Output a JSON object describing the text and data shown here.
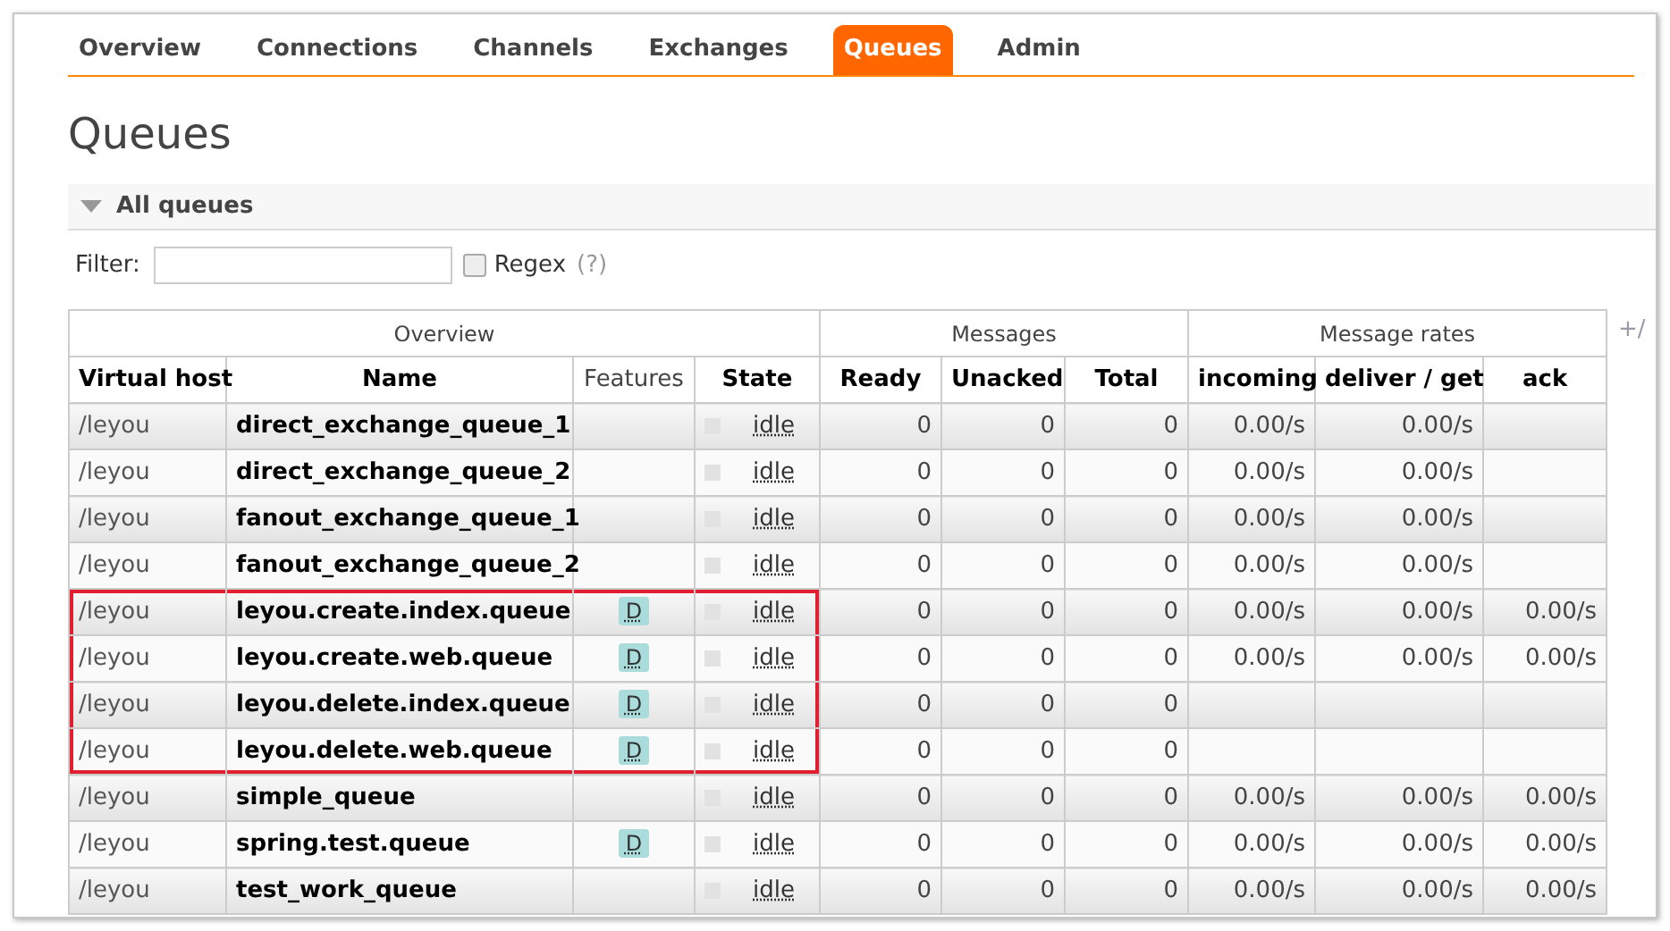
{
  "tabs": [
    {
      "label": "Overview",
      "selected": false
    },
    {
      "label": "Connections",
      "selected": false
    },
    {
      "label": "Channels",
      "selected": false
    },
    {
      "label": "Exchanges",
      "selected": false
    },
    {
      "label": "Queues",
      "selected": true
    },
    {
      "label": "Admin",
      "selected": false
    }
  ],
  "title": "Queues",
  "section": {
    "label": "All queues",
    "expanded": true
  },
  "filter": {
    "label": "Filter:",
    "regex_label": "Regex",
    "regex_checked": false,
    "help": "(?)"
  },
  "table": {
    "groups": [
      "Overview",
      "Messages",
      "Message rates"
    ],
    "toggle": "+/",
    "columns": [
      "Virtual host",
      "Name",
      "Features",
      "State",
      "Ready",
      "Unacked",
      "Total",
      "incoming",
      "deliver / get",
      "ack"
    ],
    "rows": [
      {
        "vhost": "/leyou",
        "name": "direct_exchange_queue_1",
        "features": [],
        "state": "idle",
        "ready": "0",
        "unacked": "0",
        "total": "0",
        "incoming": "0.00/s",
        "deliver": "0.00/s",
        "highlighted": false
      },
      {
        "vhost": "/leyou",
        "name": "direct_exchange_queue_2",
        "features": [],
        "state": "idle",
        "ready": "0",
        "unacked": "0",
        "total": "0",
        "incoming": "0.00/s",
        "deliver": "0.00/s",
        "highlighted": false
      },
      {
        "vhost": "/leyou",
        "name": "fanout_exchange_queue_1",
        "features": [],
        "state": "idle",
        "ready": "0",
        "unacked": "0",
        "total": "0",
        "incoming": "0.00/s",
        "deliver": "0.00/s",
        "highlighted": false
      },
      {
        "vhost": "/leyou",
        "name": "fanout_exchange_queue_2",
        "features": [],
        "state": "idle",
        "ready": "0",
        "unacked": "0",
        "total": "0",
        "incoming": "0.00/s",
        "deliver": "0.00/s",
        "highlighted": false
      },
      {
        "vhost": "/leyou",
        "name": "leyou.create.index.queue",
        "features": [
          "D"
        ],
        "state": "idle",
        "ready": "0",
        "unacked": "0",
        "total": "0",
        "incoming": "0.00/s",
        "deliver": "0.00/s",
        "ack": "0.00/s",
        "highlighted": true
      },
      {
        "vhost": "/leyou",
        "name": "leyou.create.web.queue",
        "features": [
          "D"
        ],
        "state": "idle",
        "ready": "0",
        "unacked": "0",
        "total": "0",
        "incoming": "0.00/s",
        "deliver": "0.00/s",
        "ack": "0.00/s",
        "highlighted": true
      },
      {
        "vhost": "/leyou",
        "name": "leyou.delete.index.queue",
        "features": [
          "D"
        ],
        "state": "idle",
        "ready": "0",
        "unacked": "0",
        "total": "0",
        "highlighted": true
      },
      {
        "vhost": "/leyou",
        "name": "leyou.delete.web.queue",
        "features": [
          "D"
        ],
        "state": "idle",
        "ready": "0",
        "unacked": "0",
        "total": "0",
        "highlighted": true
      },
      {
        "vhost": "/leyou",
        "name": "simple_queue",
        "features": [],
        "state": "idle",
        "ready": "0",
        "unacked": "0",
        "total": "0",
        "incoming": "0.00/s",
        "deliver": "0.00/s",
        "ack": "0.00/s",
        "highlighted": false
      },
      {
        "vhost": "/leyou",
        "name": "spring.test.queue",
        "features": [
          "D"
        ],
        "state": "idle",
        "ready": "0",
        "unacked": "0",
        "total": "0",
        "incoming": "0.00/s",
        "deliver": "0.00/s",
        "ack": "0.00/s",
        "highlighted": false
      },
      {
        "vhost": "/leyou",
        "name": "test_work_queue",
        "features": [],
        "state": "idle",
        "ready": "0",
        "unacked": "0",
        "total": "0",
        "incoming": "0.00/s",
        "deliver": "0.00/s",
        "ack": "0.00/s",
        "highlighted": false
      }
    ]
  }
}
